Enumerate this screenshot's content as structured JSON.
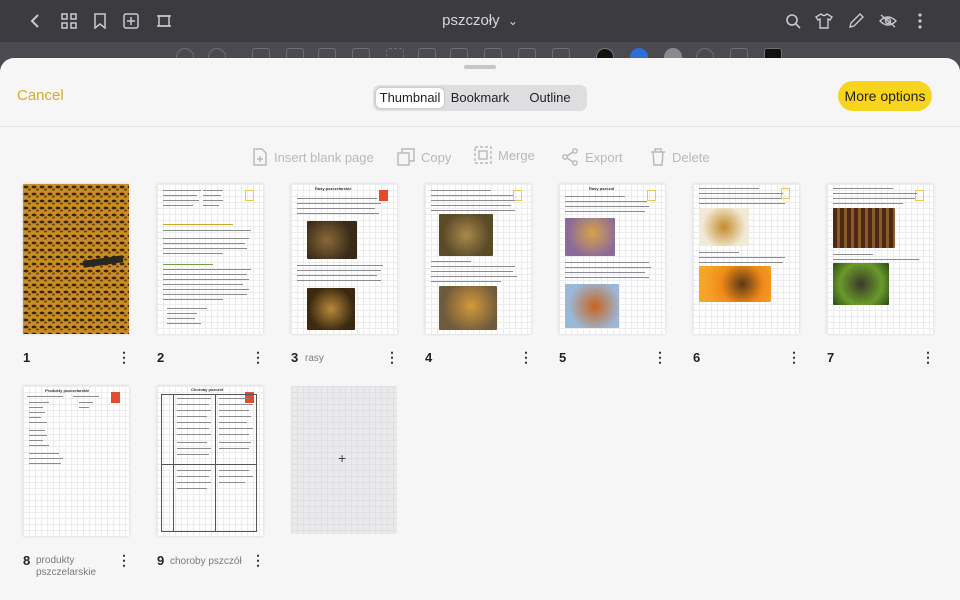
{
  "app": {
    "title": "pszczoły",
    "title_chevron": "⌄"
  },
  "top_icons_left": [
    "back-icon",
    "grid-icon",
    "bookmark-icon",
    "add-page-icon",
    "crop-icon"
  ],
  "top_icons_right": [
    "search-icon",
    "shirt-icon",
    "pen-icon",
    "eye-off-icon",
    "more-vertical-icon"
  ],
  "sheet": {
    "cancel_label": "Cancel",
    "tabs": [
      {
        "label": "Thumbnail",
        "active": true
      },
      {
        "label": "Bookmark",
        "active": false
      },
      {
        "label": "Outline",
        "active": false
      }
    ],
    "more_options_label": "More options"
  },
  "actions": [
    {
      "label": "Insert blank page",
      "icon": "insert-page-icon"
    },
    {
      "label": "Copy",
      "icon": "copy-icon"
    },
    {
      "label": "Merge",
      "icon": "merge-icon"
    },
    {
      "label": "Export",
      "icon": "share-icon"
    },
    {
      "label": "Delete",
      "icon": "trash-icon"
    }
  ],
  "pages": [
    {
      "number": "1",
      "name": ""
    },
    {
      "number": "2",
      "name": ""
    },
    {
      "number": "3",
      "name": "rasy"
    },
    {
      "number": "4",
      "name": ""
    },
    {
      "number": "5",
      "name": ""
    },
    {
      "number": "6",
      "name": ""
    },
    {
      "number": "7",
      "name": ""
    },
    {
      "number": "8",
      "name": "produkty pszczelarskie"
    },
    {
      "number": "9",
      "name": "choroby pszczół"
    }
  ],
  "page_headings": {
    "p3": "Rasy pszczelarskie",
    "p5": "Rasy pszczół",
    "p8": "Produkty pszczelarskie",
    "p9": "Choroby pszczół"
  },
  "add_page_symbol": "+",
  "kebab_symbol": "⋮",
  "colors": {
    "accent": "#f7d51e",
    "cancel": "#d9a928",
    "bookmark_red": "#e64a2e",
    "bookmark_outline": "#e9c84e"
  }
}
